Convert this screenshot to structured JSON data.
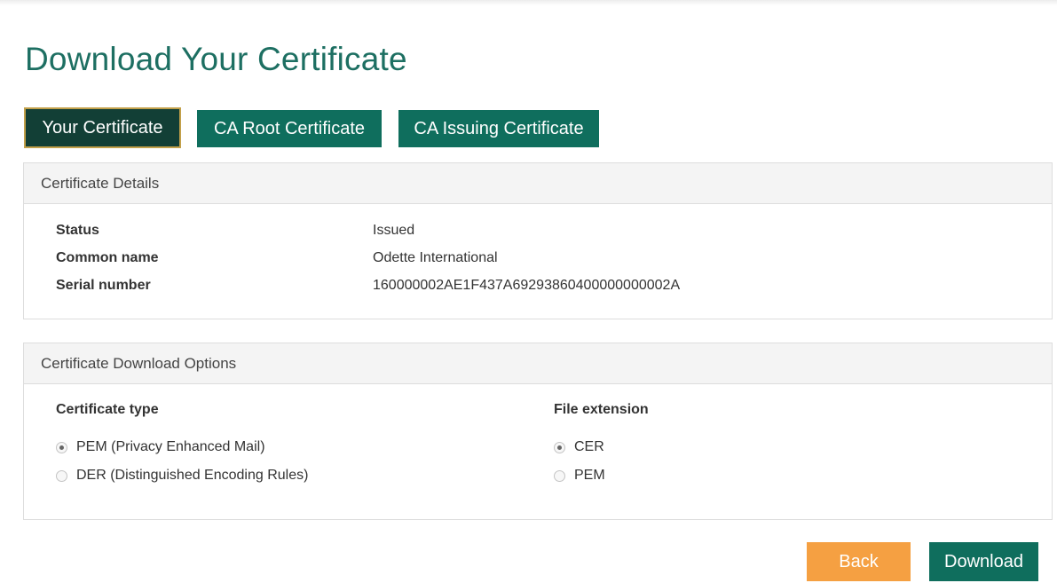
{
  "page": {
    "title": "Download Your Certificate"
  },
  "tabs": [
    {
      "label": "Your Certificate",
      "active": true
    },
    {
      "label": "CA Root Certificate",
      "active": false
    },
    {
      "label": "CA Issuing Certificate",
      "active": false
    }
  ],
  "details": {
    "heading": "Certificate Details",
    "rows": [
      {
        "label": "Status",
        "value": "Issued"
      },
      {
        "label": "Common name",
        "value": "Odette International"
      },
      {
        "label": "Serial number",
        "value": "160000002AE1F437A69293860400000000002A"
      }
    ]
  },
  "options": {
    "heading": "Certificate Download Options",
    "certificate_type": {
      "title": "Certificate type",
      "options": [
        {
          "label": "PEM (Privacy Enhanced Mail)",
          "checked": true
        },
        {
          "label": "DER (Distinguished Encoding Rules)",
          "checked": false
        }
      ]
    },
    "file_extension": {
      "title": "File extension",
      "options": [
        {
          "label": "CER",
          "checked": true
        },
        {
          "label": "PEM",
          "checked": false
        }
      ]
    }
  },
  "buttons": {
    "back_label": "Back",
    "download_label": "Download"
  },
  "colors": {
    "brand_green": "#0f6e5d",
    "active_tab": "#123f36",
    "active_tab_border": "#c2a04a",
    "title_green": "#1d6f62",
    "back_orange": "#f5a042"
  }
}
